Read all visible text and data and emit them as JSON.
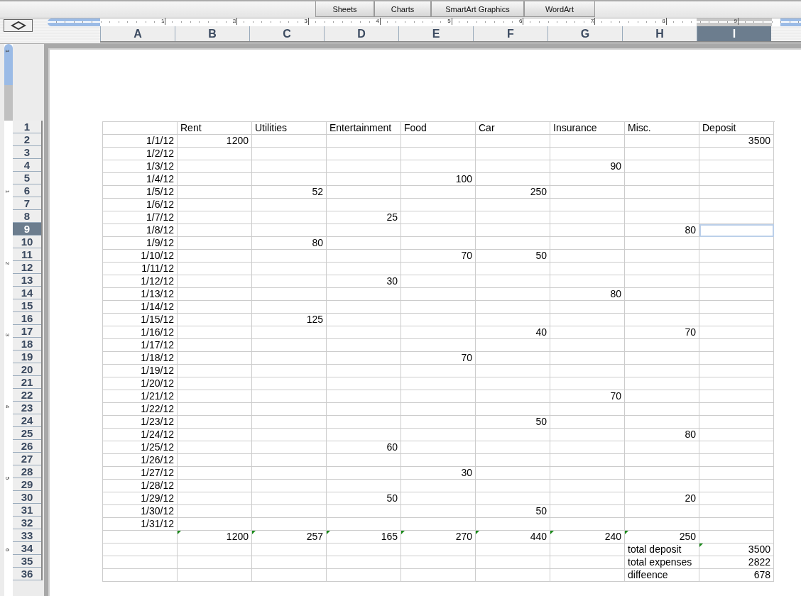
{
  "ribbon_tabs": [
    {
      "label": "Sheets"
    },
    {
      "label": "Charts"
    },
    {
      "label": "SmartArt Graphics"
    },
    {
      "label": "WordArt"
    }
  ],
  "horizontal_ruler": [
    "1",
    "2",
    "3",
    "4",
    "5",
    "6",
    "7",
    "8",
    "9"
  ],
  "vertical_ruler": [
    "1",
    "1",
    "2",
    "3",
    "4",
    "5",
    "6"
  ],
  "columns": [
    {
      "label": "A",
      "selected": false
    },
    {
      "label": "B",
      "selected": false
    },
    {
      "label": "C",
      "selected": false
    },
    {
      "label": "D",
      "selected": false
    },
    {
      "label": "E",
      "selected": false
    },
    {
      "label": "F",
      "selected": false
    },
    {
      "label": "G",
      "selected": false
    },
    {
      "label": "H",
      "selected": false
    },
    {
      "label": "I",
      "selected": true
    }
  ],
  "rows": [
    {
      "number": "1",
      "kind": "header",
      "selected": false,
      "cells": [
        "",
        "Rent",
        "Utilities",
        "Entertainment",
        "Food",
        "Car",
        "Insurance",
        "Misc.",
        "Deposit"
      ]
    },
    {
      "number": "2",
      "kind": "data",
      "selected": false,
      "cells": [
        "1/1/12",
        "1200",
        "",
        "",
        "",
        "",
        "",
        "",
        "3500"
      ]
    },
    {
      "number": "3",
      "kind": "data",
      "selected": false,
      "cells": [
        "1/2/12",
        "",
        "",
        "",
        "",
        "",
        "",
        "",
        ""
      ]
    },
    {
      "number": "4",
      "kind": "data",
      "selected": false,
      "cells": [
        "1/3/12",
        "",
        "",
        "",
        "",
        "",
        "90",
        "",
        ""
      ]
    },
    {
      "number": "5",
      "kind": "data",
      "selected": false,
      "cells": [
        "1/4/12",
        "",
        "",
        "",
        "100",
        "",
        "",
        "",
        ""
      ]
    },
    {
      "number": "6",
      "kind": "data",
      "selected": false,
      "cells": [
        "1/5/12",
        "",
        "52",
        "",
        "",
        "250",
        "",
        "",
        ""
      ]
    },
    {
      "number": "7",
      "kind": "data",
      "selected": false,
      "cells": [
        "1/6/12",
        "",
        "",
        "",
        "",
        "",
        "",
        "",
        ""
      ]
    },
    {
      "number": "8",
      "kind": "data",
      "selected": false,
      "cells": [
        "1/7/12",
        "",
        "",
        "25",
        "",
        "",
        "",
        "",
        ""
      ]
    },
    {
      "number": "9",
      "kind": "data",
      "selected": true,
      "cells": [
        "1/8/12",
        "",
        "",
        "",
        "",
        "",
        "",
        "80",
        ""
      ]
    },
    {
      "number": "10",
      "kind": "data",
      "selected": false,
      "cells": [
        "1/9/12",
        "",
        "80",
        "",
        "",
        "",
        "",
        "",
        ""
      ]
    },
    {
      "number": "11",
      "kind": "data",
      "selected": false,
      "cells": [
        "1/10/12",
        "",
        "",
        "",
        "70",
        "50",
        "",
        "",
        ""
      ]
    },
    {
      "number": "12",
      "kind": "data",
      "selected": false,
      "cells": [
        "1/11/12",
        "",
        "",
        "",
        "",
        "",
        "",
        "",
        ""
      ]
    },
    {
      "number": "13",
      "kind": "data",
      "selected": false,
      "cells": [
        "1/12/12",
        "",
        "",
        "30",
        "",
        "",
        "",
        "",
        ""
      ]
    },
    {
      "number": "14",
      "kind": "data",
      "selected": false,
      "cells": [
        "1/13/12",
        "",
        "",
        "",
        "",
        "",
        "80",
        "",
        ""
      ]
    },
    {
      "number": "15",
      "kind": "data",
      "selected": false,
      "cells": [
        "1/14/12",
        "",
        "",
        "",
        "",
        "",
        "",
        "",
        ""
      ]
    },
    {
      "number": "16",
      "kind": "data",
      "selected": false,
      "cells": [
        "1/15/12",
        "",
        "125",
        "",
        "",
        "",
        "",
        "",
        ""
      ]
    },
    {
      "number": "17",
      "kind": "data",
      "selected": false,
      "cells": [
        "1/16/12",
        "",
        "",
        "",
        "",
        "40",
        "",
        "70",
        ""
      ]
    },
    {
      "number": "18",
      "kind": "data",
      "selected": false,
      "cells": [
        "1/17/12",
        "",
        "",
        "",
        "",
        "",
        "",
        "",
        ""
      ]
    },
    {
      "number": "19",
      "kind": "data",
      "selected": false,
      "cells": [
        "1/18/12",
        "",
        "",
        "",
        "70",
        "",
        "",
        "",
        ""
      ]
    },
    {
      "number": "20",
      "kind": "data",
      "selected": false,
      "cells": [
        "1/19/12",
        "",
        "",
        "",
        "",
        "",
        "",
        "",
        ""
      ]
    },
    {
      "number": "21",
      "kind": "data",
      "selected": false,
      "cells": [
        "1/20/12",
        "",
        "",
        "",
        "",
        "",
        "",
        "",
        ""
      ]
    },
    {
      "number": "22",
      "kind": "data",
      "selected": false,
      "cells": [
        "1/21/12",
        "",
        "",
        "",
        "",
        "",
        "70",
        "",
        ""
      ]
    },
    {
      "number": "23",
      "kind": "data",
      "selected": false,
      "cells": [
        "1/22/12",
        "",
        "",
        "",
        "",
        "",
        "",
        "",
        ""
      ]
    },
    {
      "number": "24",
      "kind": "data",
      "selected": false,
      "cells": [
        "1/23/12",
        "",
        "",
        "",
        "",
        "50",
        "",
        "",
        ""
      ]
    },
    {
      "number": "25",
      "kind": "data",
      "selected": false,
      "cells": [
        "1/24/12",
        "",
        "",
        "",
        "",
        "",
        "",
        "80",
        ""
      ]
    },
    {
      "number": "26",
      "kind": "data",
      "selected": false,
      "cells": [
        "1/25/12",
        "",
        "",
        "60",
        "",
        "",
        "",
        "",
        ""
      ]
    },
    {
      "number": "27",
      "kind": "data",
      "selected": false,
      "cells": [
        "1/26/12",
        "",
        "",
        "",
        "",
        "",
        "",
        "",
        ""
      ]
    },
    {
      "number": "28",
      "kind": "data",
      "selected": false,
      "cells": [
        "1/27/12",
        "",
        "",
        "",
        "30",
        "",
        "",
        "",
        ""
      ]
    },
    {
      "number": "29",
      "kind": "data",
      "selected": false,
      "cells": [
        "1/28/12",
        "",
        "",
        "",
        "",
        "",
        "",
        "",
        ""
      ]
    },
    {
      "number": "30",
      "kind": "data",
      "selected": false,
      "cells": [
        "1/29/12",
        "",
        "",
        "50",
        "",
        "",
        "",
        "20",
        ""
      ]
    },
    {
      "number": "31",
      "kind": "data",
      "selected": false,
      "cells": [
        "1/30/12",
        "",
        "",
        "",
        "",
        "50",
        "",
        "",
        ""
      ]
    },
    {
      "number": "32",
      "kind": "data",
      "selected": false,
      "cells": [
        "1/31/12",
        "",
        "",
        "",
        "",
        "",
        "",
        "",
        ""
      ]
    },
    {
      "number": "33",
      "kind": "data",
      "selected": false,
      "flagged": [
        false,
        true,
        true,
        true,
        true,
        true,
        true,
        true,
        false
      ],
      "cells": [
        "",
        "1200",
        "257",
        "165",
        "270",
        "440",
        "240",
        "250",
        ""
      ]
    },
    {
      "number": "34",
      "kind": "summary",
      "selected": false,
      "flagged": [
        false,
        false,
        false,
        false,
        false,
        false,
        false,
        false,
        true
      ],
      "cells": [
        "",
        "",
        "",
        "",
        "",
        "",
        "",
        "total deposit",
        "3500"
      ]
    },
    {
      "number": "35",
      "kind": "summary",
      "selected": false,
      "cells": [
        "",
        "",
        "",
        "",
        "",
        "",
        "",
        "total expenses",
        "2822"
      ]
    },
    {
      "number": "36",
      "kind": "summary",
      "selected": false,
      "cells": [
        "",
        "",
        "",
        "",
        "",
        "",
        "",
        "diffeence",
        "678"
      ]
    }
  ]
}
